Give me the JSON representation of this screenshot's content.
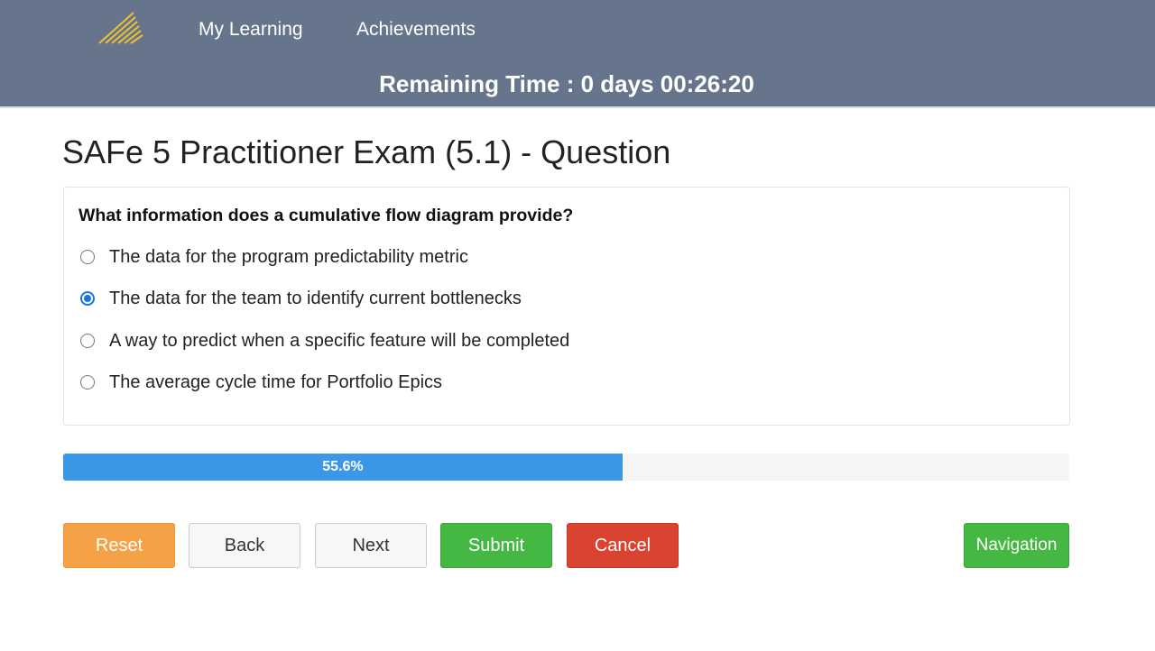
{
  "header": {
    "logo_icon": "striped-logo-icon",
    "nav": {
      "my_learning": "My Learning",
      "achievements": "Achievements"
    },
    "timer": "Remaining Time : 0 days 00:26:20"
  },
  "page": {
    "title": "SAFe 5 Practitioner Exam (5.1) - Question"
  },
  "question": {
    "text": "What information does a cumulative flow diagram provide?",
    "options": [
      {
        "label": "The data for the program predictability metric",
        "selected": false
      },
      {
        "label": "The data for the team to identify current bottlenecks",
        "selected": true
      },
      {
        "label": "A way to predict when a specific feature will be completed",
        "selected": false
      },
      {
        "label": "The average cycle time for Portfolio Epics",
        "selected": false
      }
    ]
  },
  "progress": {
    "value": 0.556,
    "label": "55.6%"
  },
  "buttons": {
    "reset": "Reset",
    "back": "Back",
    "next": "Next",
    "submit": "Submit",
    "cancel": "Cancel",
    "navigation": "Navigation"
  },
  "colors": {
    "header_bg": "#66758c",
    "progress_fill": "#3a97e8",
    "reset": "#f5a145",
    "submit": "#44b842",
    "cancel": "#d9432f",
    "logo": "#f0c030"
  }
}
